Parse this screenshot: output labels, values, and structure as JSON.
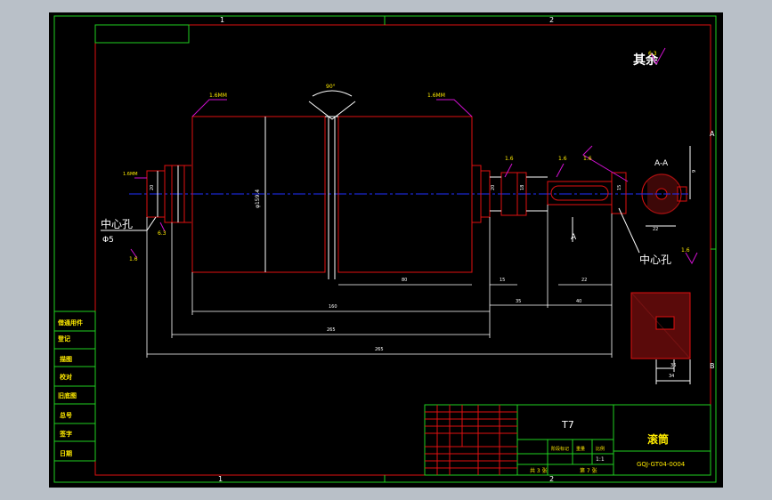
{
  "frame": {
    "zone_top_1": "1",
    "zone_top_2": "2",
    "zone_bottom_1": "1",
    "zone_bottom_2": "2",
    "zone_right_a": "A",
    "zone_right_b": "B"
  },
  "notes": {
    "rest_roughness": "其余",
    "center_hole_left": "中心孔",
    "center_hole_left_size": "Φ5",
    "center_hole_right": "中心孔",
    "section_label": "A-A",
    "section_marker": "A"
  },
  "roughness": {
    "r1": "1.6MM",
    "r2": "1.6MM",
    "r3": "1.6MM",
    "r4": "1.6",
    "r5": "1.6",
    "r6": "1.6",
    "r7": "6.3",
    "r8": "6.3",
    "r9": "1.6",
    "r10": "1.6"
  },
  "dimensions": {
    "weld_angle": "90°",
    "main_dia": "φ159.4",
    "d_80": "80",
    "d_160": "160",
    "d_265": "265",
    "d_35": "35",
    "d_40": "40",
    "d_22": "22",
    "d_15": "15",
    "d_9": "9",
    "d_36": "36",
    "d_34": "34",
    "d_20": "20",
    "d_18": "18"
  },
  "title_block": {
    "material": "T7",
    "part_name": "滚筒",
    "drawing_no": "GQJ-GT04-0004",
    "scale_label": "比例",
    "scale_value": "1:1",
    "sheet_info": "共 3 张",
    "sheet_no": "第 7 张",
    "weight_label": "重量",
    "stage_label": "阶段标记"
  },
  "side_block": {
    "row1": "借通用件",
    "row2": "登记",
    "row3": "描图",
    "row4": "校对",
    "row5": "旧底图",
    "row6": "总号",
    "row7": "签字",
    "row8": "日期"
  }
}
